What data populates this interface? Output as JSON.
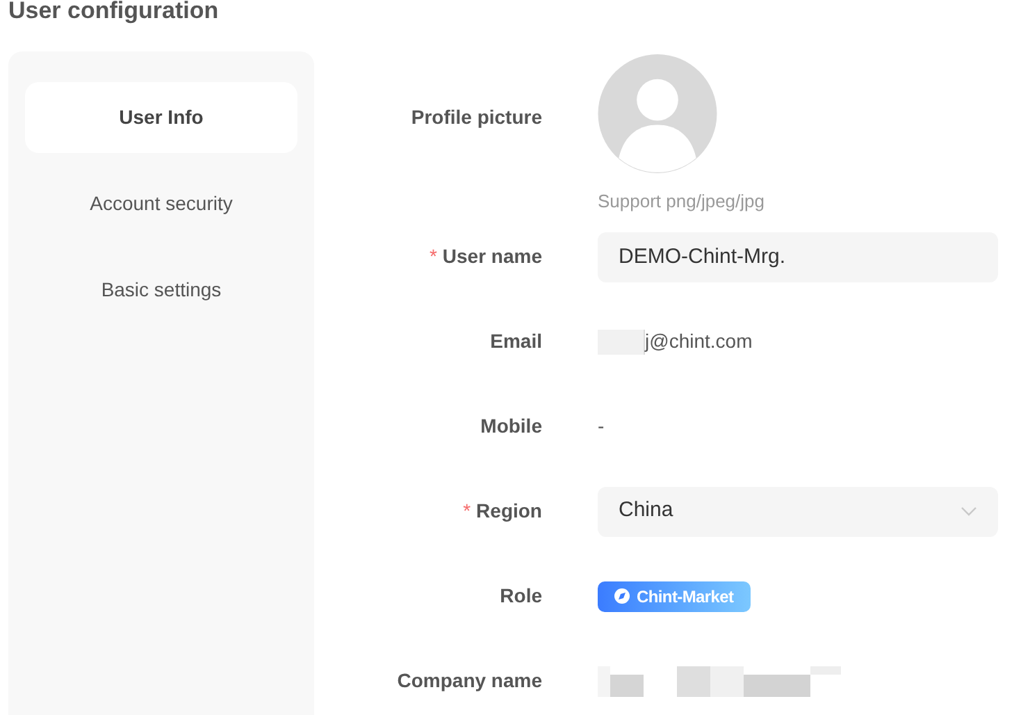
{
  "title": "User configuration",
  "nav": [
    {
      "label": "User Info",
      "selected": true
    },
    {
      "label": "Account security",
      "selected": false
    },
    {
      "label": "Basic settings",
      "selected": false
    }
  ],
  "profile": {
    "label": "Profile picture",
    "hint": "Support png/jpeg/jpg"
  },
  "fields": [
    {
      "kind": "input",
      "label": "User name",
      "required_mark": "*",
      "value": "DEMO-Chint-Mrg."
    },
    {
      "kind": "redacted-text",
      "label": "Email",
      "value": "j@chint.com"
    },
    {
      "kind": "text",
      "label": "Mobile",
      "value": "-"
    },
    {
      "kind": "select",
      "label": "Region",
      "required_mark": "*",
      "value": "China"
    },
    {
      "kind": "tag",
      "label": "Role",
      "value": "Chint-Market"
    },
    {
      "kind": "redacted",
      "label": "Company name"
    }
  ]
}
